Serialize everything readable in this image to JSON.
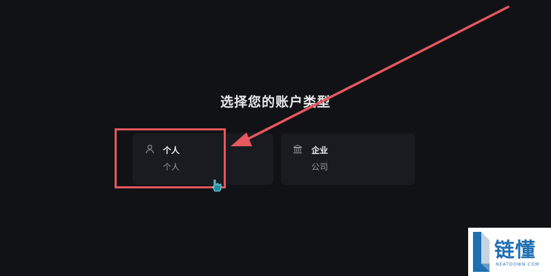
{
  "page": {
    "title": "选择您的账户类型"
  },
  "account_types": [
    {
      "label": "个人",
      "description": "个人",
      "icon": "user-icon"
    },
    {
      "label": "企业",
      "description": "公司",
      "icon": "bank-building-icon"
    }
  ],
  "annotation": {
    "color": "#e8585f"
  },
  "watermark": {
    "text": "链懂",
    "subtext": "NEATDOWN.COM"
  },
  "colors": {
    "background": "#111216",
    "card": "#1a1b20",
    "accent_blue": "#1f6fb2"
  }
}
